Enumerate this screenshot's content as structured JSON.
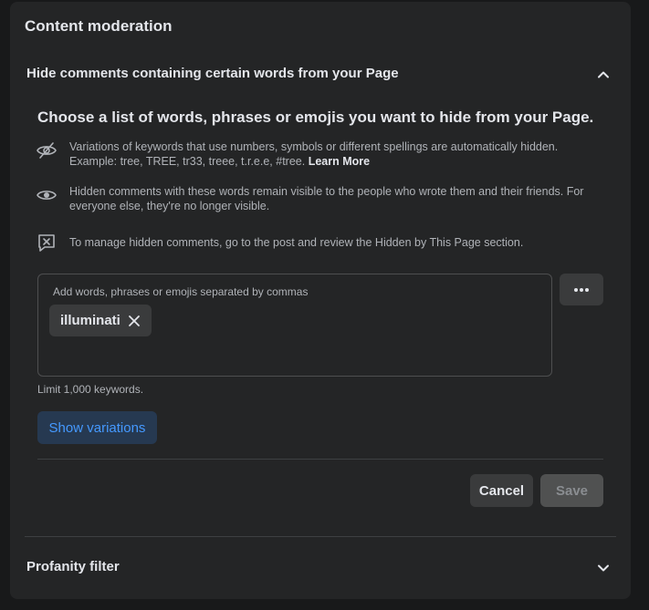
{
  "card": {
    "title": "Content moderation"
  },
  "hide_section": {
    "header": "Hide comments containing certain words from your Page",
    "heading": "Choose a list of words, phrases or emojis you want to hide from your Page.",
    "info": [
      {
        "icon": "eye-slash-icon",
        "text": "Variations of keywords that use numbers, symbols or different spellings are automatically hidden. Example: tree, TREE, tr33, treee, t.r.e.e, #tree.",
        "link": "Learn More"
      },
      {
        "icon": "eye-icon",
        "text": "Hidden comments with these words remain visible to the people who wrote them and their friends. For everyone else, they're no longer visible."
      },
      {
        "icon": "comment-x-icon",
        "text": "To manage hidden comments, go to the post and review the Hidden by This Page section."
      }
    ],
    "keywords": {
      "placeholder": "Add words, phrases or emojis separated by commas",
      "items": [
        "illuminati"
      ],
      "limit": "Limit 1,000 keywords."
    },
    "show_variations": "Show variations",
    "cancel": "Cancel",
    "save": "Save"
  },
  "profanity": {
    "header": "Profanity filter"
  },
  "colors": {
    "accent": "#4599ff",
    "background": "#242526",
    "page": "#18191a"
  }
}
